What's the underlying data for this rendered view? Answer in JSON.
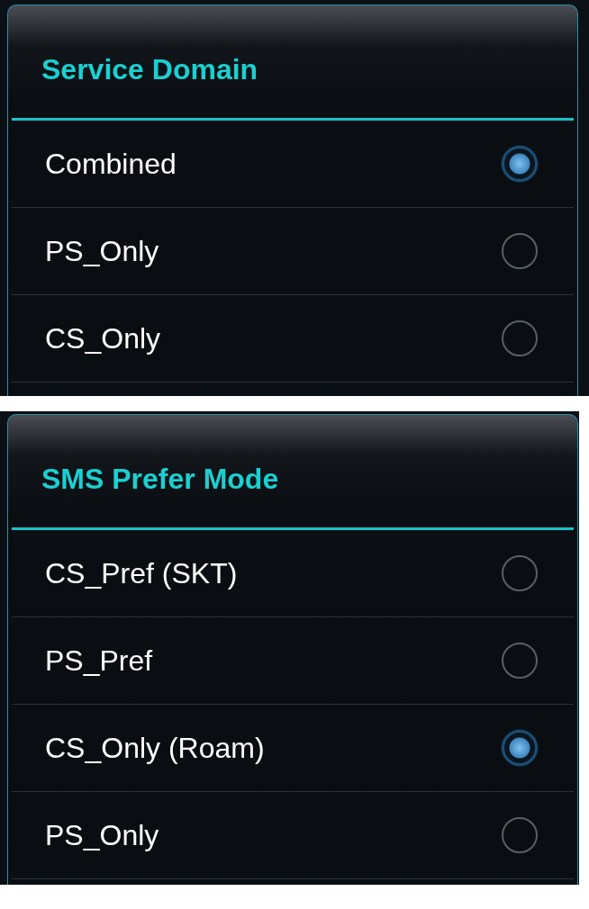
{
  "panels": [
    {
      "dialog": {
        "title": "Service Domain",
        "options": [
          {
            "label": "Combined",
            "selected": true
          },
          {
            "label": "PS_Only",
            "selected": false
          },
          {
            "label": "CS_Only",
            "selected": false
          }
        ]
      }
    },
    {
      "dialog": {
        "title": "SMS Prefer Mode",
        "options": [
          {
            "label": "CS_Pref (SKT)",
            "selected": false
          },
          {
            "label": "PS_Pref",
            "selected": false
          },
          {
            "label": "CS_Only (Roam)",
            "selected": true
          },
          {
            "label": "PS_Only",
            "selected": false
          }
        ]
      }
    }
  ]
}
